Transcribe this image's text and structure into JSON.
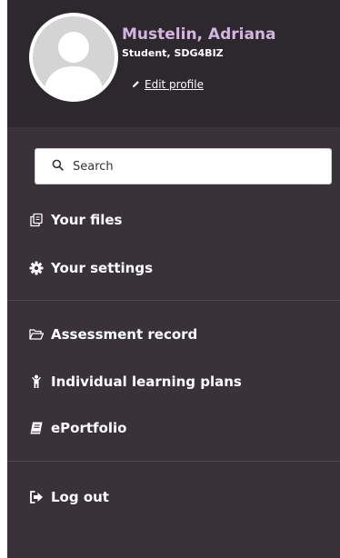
{
  "profile": {
    "name": "Mustelin, Adriana",
    "role": "Student, SDG4BIZ",
    "edit_label": "Edit profile",
    "name_color": "#d3b6e0"
  },
  "search": {
    "placeholder": "Search"
  },
  "nav": {
    "your_files": "Your files",
    "your_settings": "Your settings",
    "assessment_record": "Assessment record",
    "individual_learning_plans": "Individual learning plans",
    "eportfolio": "ePortfolio",
    "log_out": "Log out"
  },
  "icons": {
    "your_files": "files-icon",
    "your_settings": "gear-icon",
    "assessment_record": "folder-open-icon",
    "individual_learning_plans": "person-icon",
    "eportfolio": "book-icon",
    "log_out": "logout-icon",
    "search": "search-icon",
    "edit": "pencil-icon"
  },
  "colors": {
    "panel_bg": "#393339",
    "profile_bg": "#2d282d",
    "text": "#ffffff"
  }
}
